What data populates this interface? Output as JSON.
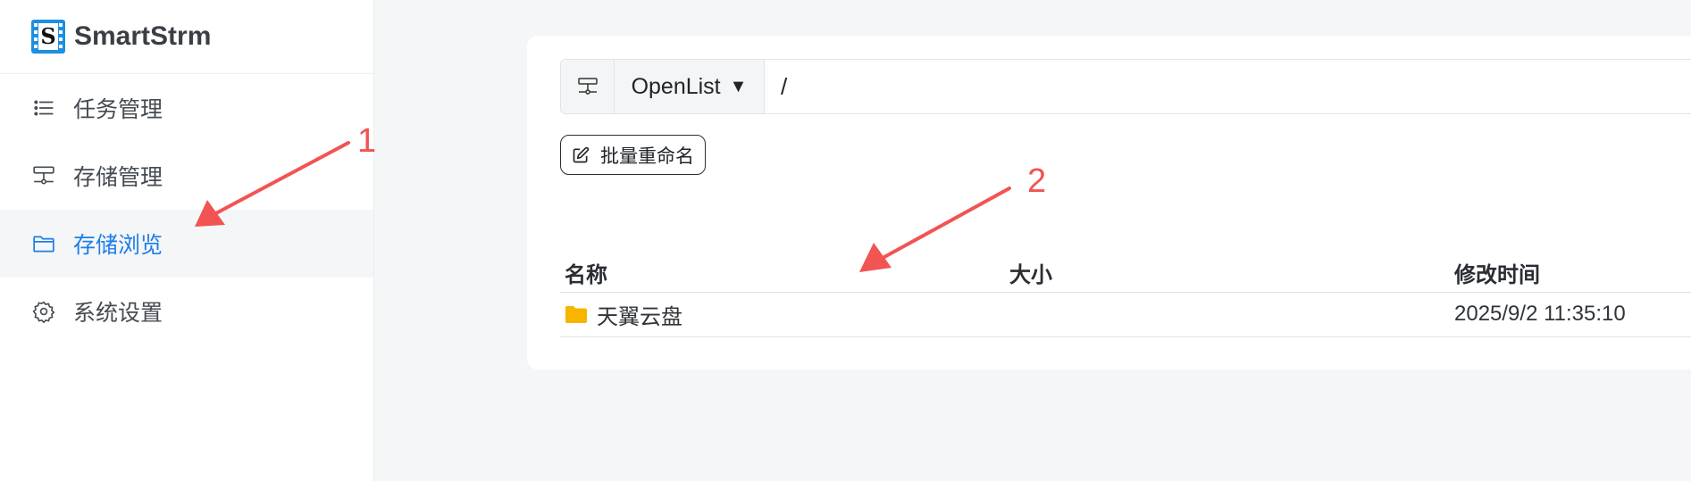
{
  "app": {
    "name": "SmartStrm",
    "logo_letter": "S"
  },
  "sidebar": {
    "items": [
      {
        "label": "任务管理",
        "icon": "list-icon",
        "active": false
      },
      {
        "label": "存储管理",
        "icon": "storage-icon",
        "active": false
      },
      {
        "label": "存储浏览",
        "icon": "folder-icon",
        "active": true
      },
      {
        "label": "系统设置",
        "icon": "gear-icon",
        "active": false
      }
    ]
  },
  "browser": {
    "storage_name": "OpenList",
    "path": "/",
    "rename_button": "批量重命名",
    "columns": {
      "name": "名称",
      "size": "大小",
      "modified": "修改时间"
    },
    "rows": [
      {
        "name": "天翼云盘",
        "size": "",
        "modified": "2025/9/2 11:35:10",
        "type": "folder"
      }
    ]
  },
  "annotations": {
    "label_1": "1",
    "label_2": "2"
  },
  "colors": {
    "accent": "#1e7de8",
    "annotation": "#f25353",
    "folder": "#f7b500"
  }
}
